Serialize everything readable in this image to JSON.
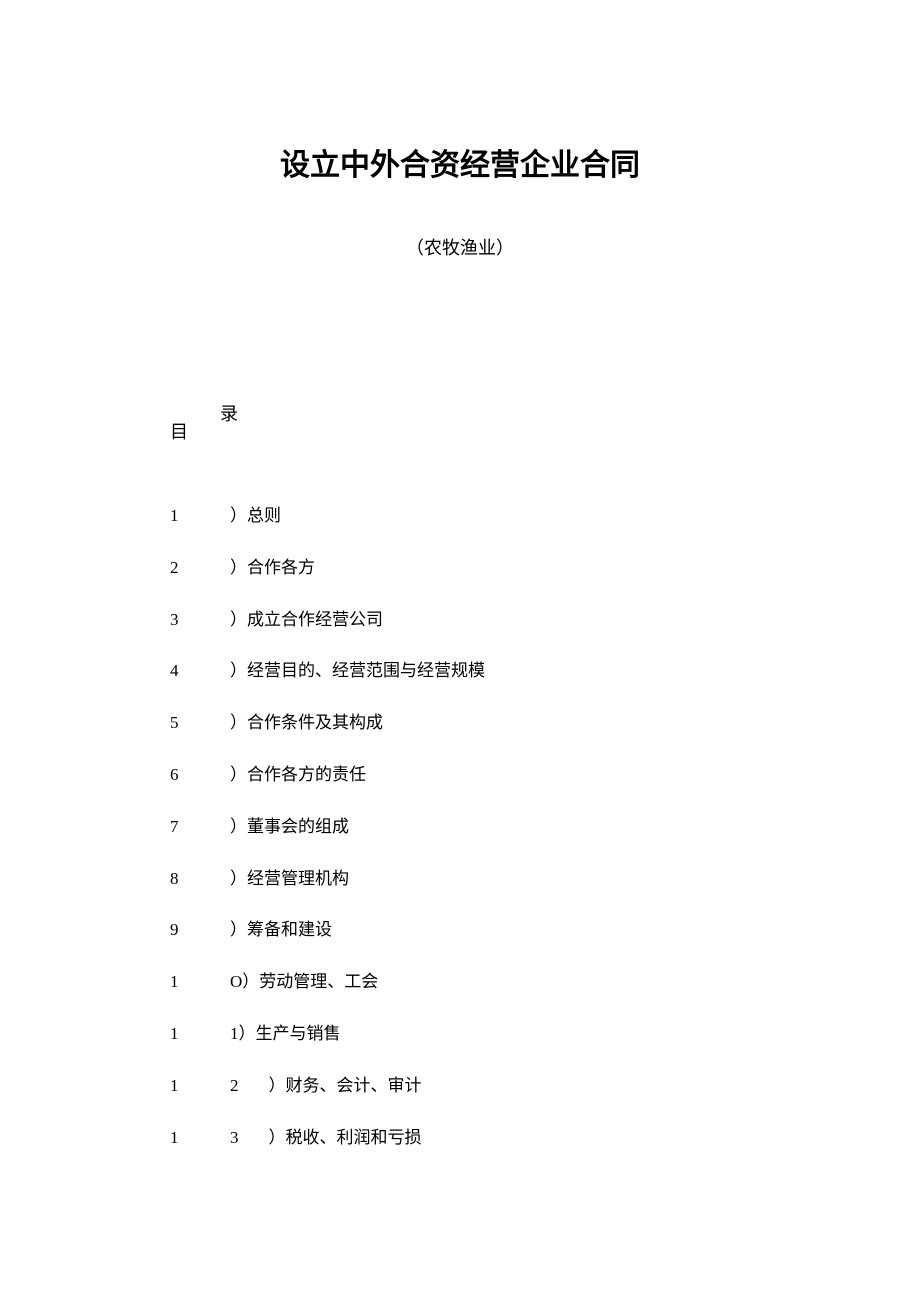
{
  "title": "设立中外合资经营企业合同",
  "subtitle": "（农牧渔业）",
  "toc_label_1": "目",
  "toc_label_2": "录",
  "toc": [
    {
      "num": "1",
      "text": "）总则"
    },
    {
      "num": "2",
      "text": "）合作各方"
    },
    {
      "num": "3",
      "text": "）成立合作经营公司"
    },
    {
      "num": "4",
      "text": "）经营目的、经营范围与经营规模"
    },
    {
      "num": "5",
      "text": "）合作条件及其构成"
    },
    {
      "num": "6",
      "text": "）合作各方的责任"
    },
    {
      "num": "7",
      "text": "）董事会的组成"
    },
    {
      "num": "8",
      "text": "）经营管理机构"
    },
    {
      "num": "9",
      "text": "）筹备和建设"
    },
    {
      "num": "1",
      "sub": "O",
      "text": "）劳动管理、工会"
    },
    {
      "num": "1",
      "sub": "1",
      "text": "）生产与销售"
    },
    {
      "num": "1",
      "sub": "2",
      "gap": true,
      "text": "）财务、会计、审计"
    },
    {
      "num": "1",
      "sub": "3",
      "gap": true,
      "text": "）税收、利润和亏损"
    }
  ]
}
